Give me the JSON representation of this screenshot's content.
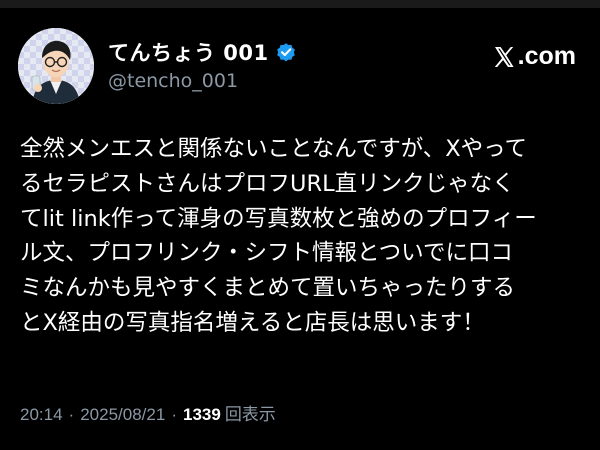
{
  "author": {
    "display_name": "てんちょう 001",
    "handle": "@tencho_001",
    "verified": true,
    "avatar_icon": "avatar-illustration"
  },
  "brand": {
    "label": ".com",
    "icon": "x-logo-icon"
  },
  "tweet": {
    "text": "全然メンエスと関係ないことなんですが、Xやって\nるセラピストさんはプロフURL直リンクじゃなく\nてlit link作って渾身の写真数枚と強めのプロフィー\nル文、プロフリンク・シフト情報とついでに口コ\nミなんかも見やすくまとめて置いちゃったりする\nとX経由の写真指名増えると店長は思います！"
  },
  "meta": {
    "time": "20:14",
    "separator": "·",
    "date": "2025/08/21",
    "views_count": "1339",
    "views_label": "回表示"
  },
  "colors": {
    "background": "#000000",
    "text": "#ffffff",
    "muted": "#8b98a5",
    "verified_badge": "#1d9bf0"
  }
}
